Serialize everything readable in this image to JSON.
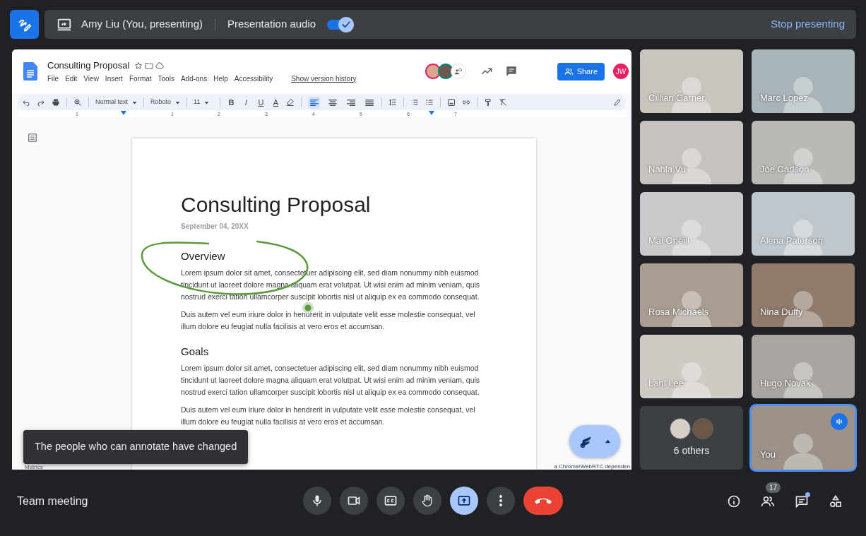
{
  "presenting_bar": {
    "presenter": "Amy Liu (You, presenting)",
    "audio_label": "Presentation audio",
    "audio_on": true,
    "stop": "Stop presenting"
  },
  "document": {
    "title": "Consulting Proposal",
    "menus": [
      "File",
      "Edit",
      "View",
      "Insert",
      "Format",
      "Tools",
      "Add-ons",
      "Help",
      "Accessibility"
    ],
    "version_history": "Show version history",
    "share": "Share",
    "user_initials": "JW",
    "toolbar": {
      "style": "Normal text",
      "font": "Roboto",
      "size": "11",
      "letters": [
        "B",
        "I",
        "U",
        "A"
      ],
      "alignments": [
        {
          "selected": true
        },
        {
          "selected": false
        },
        {
          "selected": false
        },
        {
          "selected": false
        }
      ]
    },
    "ruler": [
      "1",
      "1",
      "2",
      "3",
      "4",
      "5",
      "6",
      "7"
    ],
    "page": {
      "title": "Consulting Proposal",
      "date": "September 04, 20XX",
      "sections": [
        {
          "heading": "Overview",
          "paragraphs": [
            "Lorem ipsum dolor sit amet, consectetuer adipiscing elit, sed diam nonummy nibh euismod tincidunt ut laoreet dolore magna aliquam erat volutpat. Ut wisi enim ad minim veniam, quis nostrud exerci tation ullamcorper suscipit lobortis nisl ut aliquip ex ea commodo consequat.",
            "Duis autem vel eum iriure dolor in hendrerit in vulputate velit esse molestie consequat, vel illum dolore eu feugiat nulla facilisis at vero eros et accumsan."
          ]
        },
        {
          "heading": "Goals",
          "paragraphs": [
            "Lorem ipsum dolor sit amet, consectetuer adipiscing elit, sed diam nonummy nibh euismod tincidunt ut laoreet dolore magna aliquam erat volutpat. Ut wisi enim ad minim veniam, quis nostrud exerci tation ullamcorper suscipit lobortis nisl ut aliquip ex ea commodo consequat.",
            "Duis autem vel eum iriure dolor in hendrerit in vulputate velit esse molestie consequat, vel illum dolore eu feugiat nulla facilisis at vero eros et accumsan."
          ]
        }
      ]
    },
    "footer_left": "Metrics",
    "footer_right": "a Chrome/WebRTC dependen"
  },
  "toast": "The people who can annotate have changed",
  "participants": [
    {
      "name": "Cillian Garner",
      "speaking": false
    },
    {
      "name": "Marc Lopez",
      "speaking": false
    },
    {
      "name": "Nahla Vu",
      "speaking": false
    },
    {
      "name": "Joe Carlson",
      "speaking": false
    },
    {
      "name": "Mai Oneill",
      "speaking": false
    },
    {
      "name": "Alena Paterson",
      "speaking": false
    },
    {
      "name": "Rosa Michaels",
      "speaking": false
    },
    {
      "name": "Nina Duffy",
      "speaking": false
    },
    {
      "name": "Lani Lee",
      "speaking": false
    },
    {
      "name": "Hugo Novak",
      "speaking": false
    }
  ],
  "others": {
    "label": "6 others"
  },
  "self": {
    "name": "You",
    "speaking": true
  },
  "meeting_name": "Team meeting",
  "controls": [
    {
      "kind": "mic",
      "selected": false
    },
    {
      "kind": "camera",
      "selected": false
    },
    {
      "kind": "captions",
      "selected": false
    },
    {
      "kind": "hand",
      "selected": false
    },
    {
      "kind": "present",
      "selected": true
    },
    {
      "kind": "more",
      "selected": false
    },
    {
      "kind": "end",
      "selected": false
    }
  ],
  "side_controls": [
    {
      "kind": "info"
    },
    {
      "kind": "people",
      "badge": "17"
    },
    {
      "kind": "chat",
      "notification": true
    },
    {
      "kind": "activities"
    }
  ]
}
